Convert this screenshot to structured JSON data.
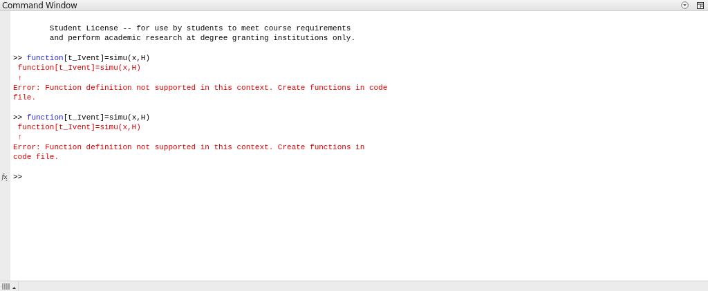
{
  "window": {
    "title": "Command Window"
  },
  "lines": [
    {
      "kind": "license",
      "text": "Student License -- for use by students to meet course requirements"
    },
    {
      "kind": "license",
      "text": "and perform academic research at degree granting institutions only."
    },
    {
      "kind": "blank"
    },
    {
      "kind": "prompt",
      "prompt": ">>",
      "keyword": "function",
      "text": "[t_Ivent]=simu(x,H)"
    },
    {
      "kind": "echo",
      "text": "function[t_Ivent]=simu(x,H)"
    },
    {
      "kind": "caret",
      "text": "↑"
    },
    {
      "kind": "error",
      "text": "Error: Function definition not supported in this context. Create functions in code"
    },
    {
      "kind": "error",
      "text": "file."
    },
    {
      "kind": "blank"
    },
    {
      "kind": "prompt",
      "prompt": ">>",
      "keyword": "function",
      "text": "[t_Ivent]=simu(x,H)"
    },
    {
      "kind": "echo",
      "text": "function[t_Ivent]=simu(x,H)"
    },
    {
      "kind": "caret",
      "text": "↑"
    },
    {
      "kind": "error",
      "text": "Error: Function definition not supported in this context. Create functions in"
    },
    {
      "kind": "error",
      "text": "code file."
    },
    {
      "kind": "blank"
    },
    {
      "kind": "input",
      "prompt": ">>"
    }
  ]
}
